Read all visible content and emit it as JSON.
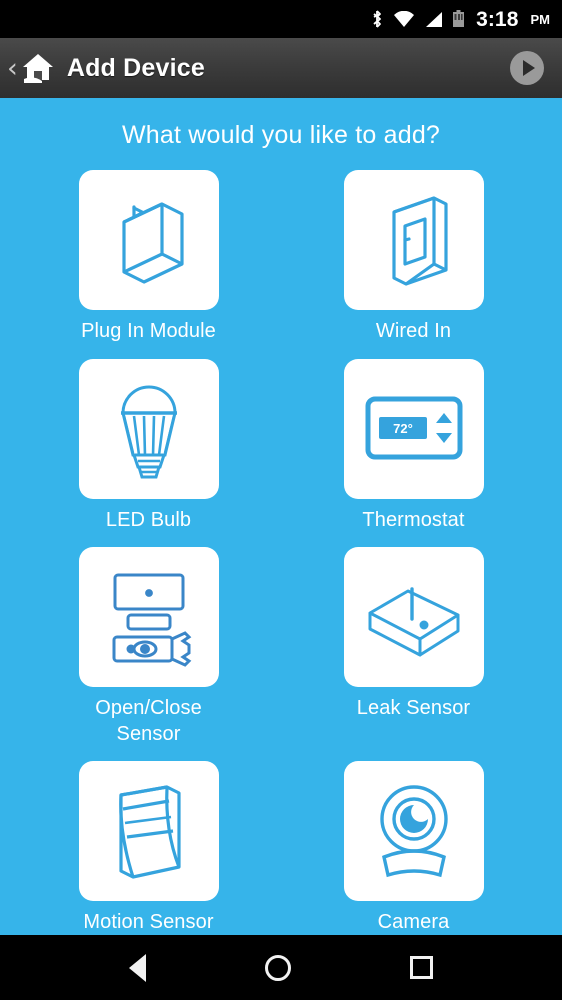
{
  "status_bar": {
    "icons": [
      "bluetooth-icon",
      "wifi-icon",
      "cellular-signal-icon",
      "battery-icon"
    ],
    "time": "3:18",
    "ampm": "PM"
  },
  "action_bar": {
    "back_label": "‹",
    "home_icon": "home-icon",
    "title": "Add Device",
    "next_icon": "play-icon"
  },
  "main": {
    "prompt": "What would you like to add?",
    "background_color": "#36b4ea",
    "accent_color": "#2f9fd8",
    "tiles": [
      {
        "label": "Plug In Module",
        "icon": "plug-in-module-icon"
      },
      {
        "label": "Wired In",
        "icon": "wall-switch-icon"
      },
      {
        "label": "LED Bulb",
        "icon": "led-bulb-icon"
      },
      {
        "label": "Thermostat",
        "icon": "thermostat-icon",
        "display_value": "72°"
      },
      {
        "label": "Open/Close Sensor",
        "icon": "open-close-sensor-icon"
      },
      {
        "label": "Leak Sensor",
        "icon": "leak-sensor-icon"
      },
      {
        "label": "Motion Sensor",
        "icon": "motion-sensor-icon"
      },
      {
        "label": "Camera",
        "icon": "camera-icon"
      }
    ]
  },
  "nav_bar": {
    "back": "back-icon",
    "home": "home-circle-icon",
    "recents": "recents-icon"
  }
}
